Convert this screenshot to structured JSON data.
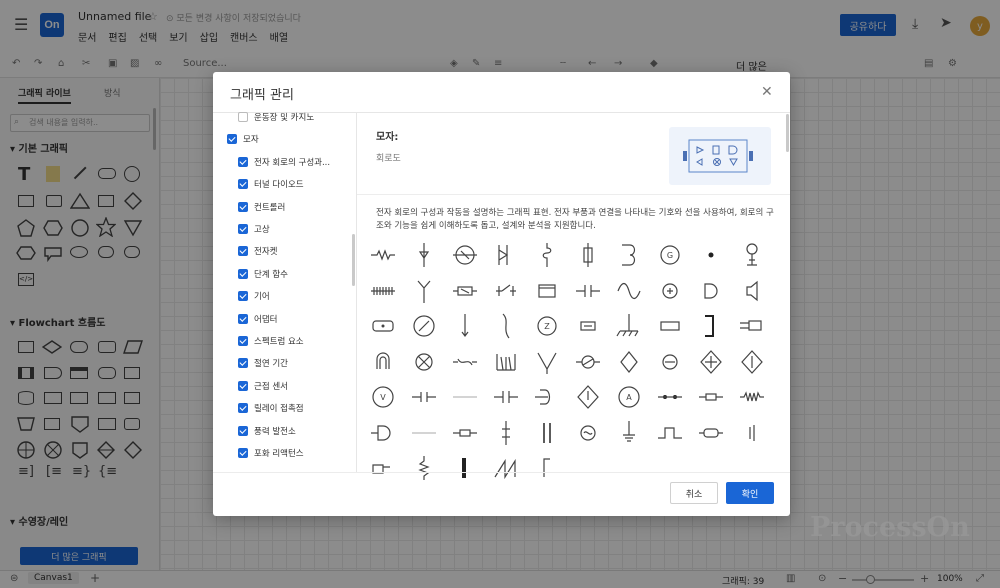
{
  "header": {
    "logo": "On",
    "filename": "Unnamed file",
    "save_status": "모든 변경 사항이 저장되었습니다",
    "menu": [
      "문서",
      "편집",
      "선택",
      "보기",
      "삽입",
      "캔버스",
      "배열"
    ],
    "share": "공유하다",
    "avatar": "y"
  },
  "toolbar": {
    "font": "Source...",
    "more": "더 많은"
  },
  "sidebar": {
    "tabs": [
      "그래픽 라이브",
      "방식"
    ],
    "search_placeholder": "검색 내용을 입력하..",
    "sections": [
      "기본 그래픽",
      "Flowchart 흐름도",
      "수영장/레인"
    ],
    "more_button": "더 많은 그래픽"
  },
  "statusbar": {
    "page": "Canvas1",
    "count": "그래픽: 39",
    "zoom": "100%"
  },
  "modal": {
    "title": "그래픽 관리",
    "libraries": [
      {
        "label": "운동장 및 카지노",
        "checked": false,
        "level": 1
      },
      {
        "label": "모자",
        "checked": true,
        "level": 0
      },
      {
        "label": "전자 회로의 구성과...",
        "checked": true,
        "level": 1
      },
      {
        "label": "터널 다이오드",
        "checked": true,
        "level": 1
      },
      {
        "label": "컨트롤러",
        "checked": true,
        "level": 1
      },
      {
        "label": "고상",
        "checked": true,
        "level": 1
      },
      {
        "label": "전자켓",
        "checked": true,
        "level": 1
      },
      {
        "label": "단계 함수",
        "checked": true,
        "level": 1
      },
      {
        "label": "기어",
        "checked": true,
        "level": 1
      },
      {
        "label": "어댑터",
        "checked": true,
        "level": 1
      },
      {
        "label": "스펙트럼 요소",
        "checked": true,
        "level": 1
      },
      {
        "label": "절연 기간",
        "checked": true,
        "level": 1
      },
      {
        "label": "근접 센서",
        "checked": true,
        "level": 1
      },
      {
        "label": "릴레이 접촉점",
        "checked": true,
        "level": 1
      },
      {
        "label": "풍력 발전소",
        "checked": true,
        "level": 1
      },
      {
        "label": "포화 리액턴스",
        "checked": true,
        "level": 1
      }
    ],
    "detail": {
      "name": "모자:",
      "category": "회로도",
      "description": "전자 회로의 구성과 작동을 설명하는 그래픽 표현. 전자 부품과 연결을 나타내는 기호와 선을 사용하여, 회로의 구조와 기능을 쉽게 이해하도록 돕고, 설계와 분석을 지원합니다."
    },
    "cancel": "취소",
    "confirm": "확인"
  },
  "watermark": "ProcessOn"
}
